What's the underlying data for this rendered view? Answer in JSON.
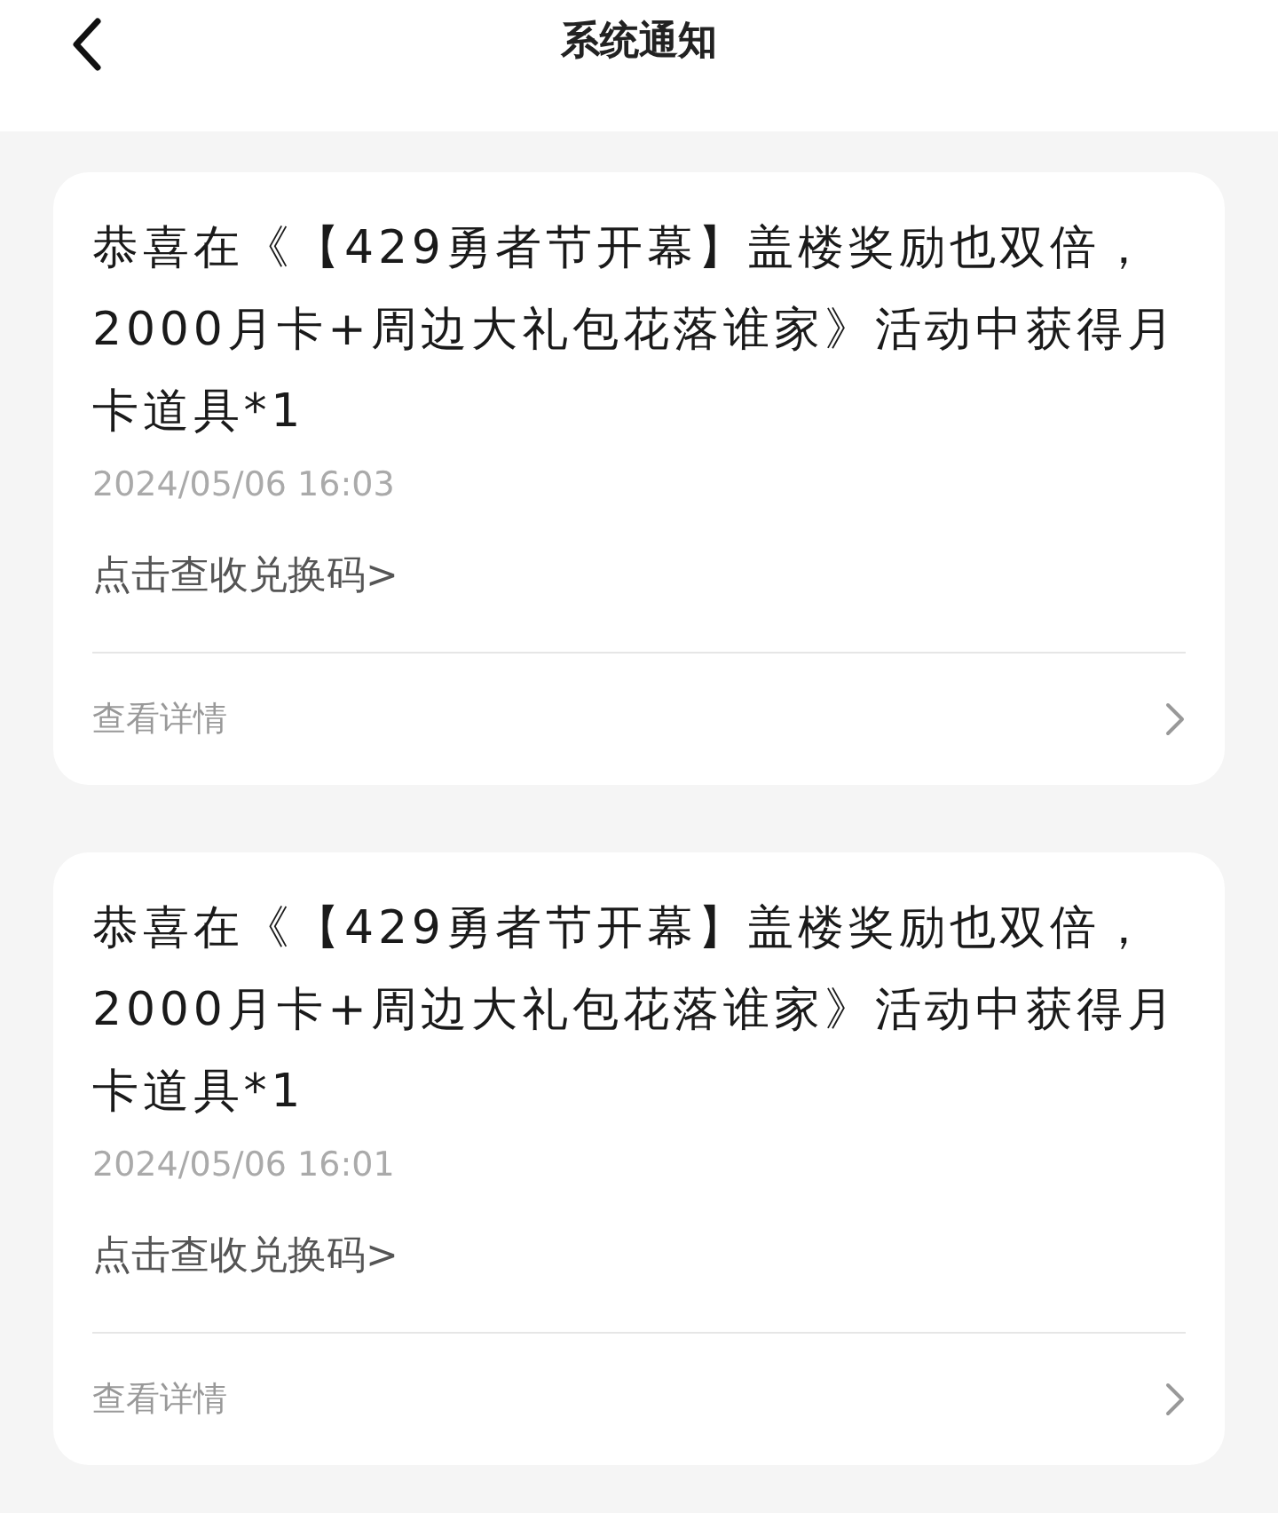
{
  "header": {
    "title": "系统通知"
  },
  "notices": [
    {
      "message": "恭喜在《【429勇者节开幕】盖楼奖励也双倍，2000月卡+周边大礼包花落谁家》活动中获得月卡道具*1",
      "time": "2024/05/06 16:03",
      "action": "点击查收兑换码>",
      "details": "查看详情"
    },
    {
      "message": "恭喜在《【429勇者节开幕】盖楼奖励也双倍，2000月卡+周边大礼包花落谁家》活动中获得月卡道具*1",
      "time": "2024/05/06 16:01",
      "action": "点击查收兑换码>",
      "details": "查看详情"
    }
  ]
}
